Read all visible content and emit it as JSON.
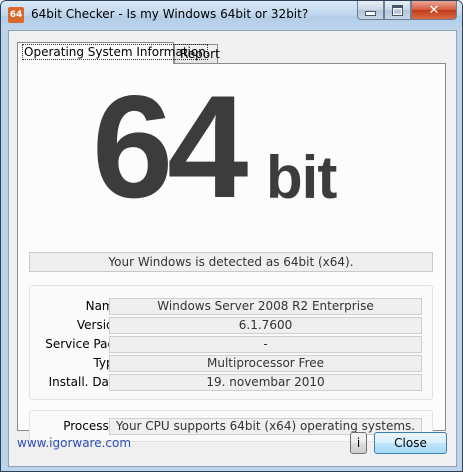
{
  "window": {
    "title": "64bit Checker - Is my Windows 64bit or 32bit?",
    "icon_text": "64"
  },
  "tabs": [
    {
      "label": "Operating System Information",
      "active": true
    },
    {
      "label": "Report",
      "active": false
    }
  ],
  "hero": {
    "number": "64",
    "unit": "bit"
  },
  "detected_text": "Your Windows is detected as 64bit (x64).",
  "os_info": [
    {
      "label": "Name",
      "value": "Windows Server 2008 R2 Enterprise"
    },
    {
      "label": "Version",
      "value": "6.1.7600"
    },
    {
      "label": "Service Pack",
      "value": "-"
    },
    {
      "label": "Type",
      "value": "Multiprocessor Free"
    },
    {
      "label": "Install. Date",
      "value": "19. novembar 2010"
    }
  ],
  "processor": {
    "label": "Processor",
    "value": "Your CPU supports 64bit (x64) operating systems."
  },
  "footer": {
    "link": "www.igorware.com",
    "info_button": "i",
    "close_button": "Close"
  },
  "colors": {
    "hero_text": "#3c3c3c",
    "link": "#2a4fba",
    "titlebar": "#c2d8ee"
  }
}
